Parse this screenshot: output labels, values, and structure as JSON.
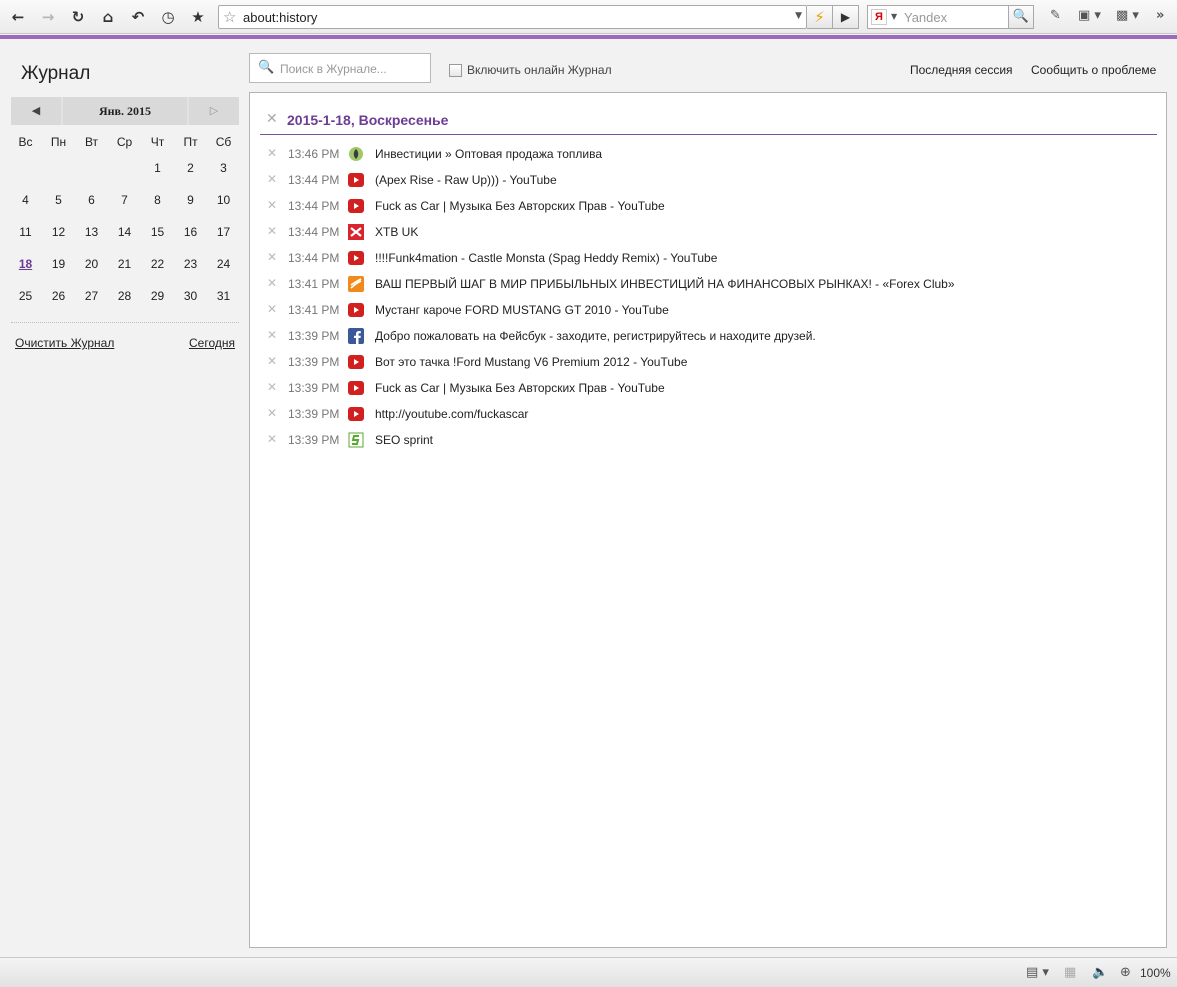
{
  "toolbar": {
    "url": "about:history",
    "search_engine_badge": "Я",
    "search_placeholder": "Yandex",
    "icons": [
      "back-icon",
      "forward-icon",
      "reload-icon",
      "home-icon",
      "undo-icon",
      "history-icon",
      "bookmark-star-icon",
      "lightning-icon",
      "go-icon",
      "search-icon",
      "pencil-icon",
      "camera-icon",
      "puzzle-icon",
      "overflow-icon"
    ]
  },
  "sidebar": {
    "title": "Журнал",
    "calendar": {
      "month": "Янв. 2015",
      "weekdays": [
        "Вс",
        "Пн",
        "Вт",
        "Ср",
        "Чт",
        "Пт",
        "Сб"
      ],
      "weeks": [
        [
          "",
          "",
          "",
          "",
          "1",
          "2",
          "3"
        ],
        [
          "4",
          "5",
          "6",
          "7",
          "8",
          "9",
          "10"
        ],
        [
          "11",
          "12",
          "13",
          "14",
          "15",
          "16",
          "17"
        ],
        [
          "18",
          "19",
          "20",
          "21",
          "22",
          "23",
          "24"
        ],
        [
          "25",
          "26",
          "27",
          "28",
          "29",
          "30",
          "31"
        ]
      ],
      "selected_day": "18"
    },
    "clear_label": "Очистить Журнал",
    "today_label": "Сегодня"
  },
  "top": {
    "search_placeholder": "Поиск в Журнале...",
    "online_label": "Включить онлайн Журнал",
    "last_session": "Последняя сессия",
    "report": "Сообщить о проблеме"
  },
  "day": {
    "title": "2015-1-18, Воскресенье",
    "entries": [
      {
        "time": "13:46 PM",
        "icon": "investment-site-icon",
        "title": "Инвестиции » Оптовая продажа топлива"
      },
      {
        "time": "13:44 PM",
        "icon": "youtube-icon",
        "title": "(Apex Rise - Raw Up))) - YouTube"
      },
      {
        "time": "13:44 PM",
        "icon": "youtube-icon",
        "title": "Fuck as Car | Музыка Без Авторских Прав - YouTube"
      },
      {
        "time": "13:44 PM",
        "icon": "xtb-icon",
        "title": "XTB UK"
      },
      {
        "time": "13:44 PM",
        "icon": "youtube-icon",
        "title": "!!!!Funk4mation - Castle Monsta (Spag Heddy Remix) - YouTube"
      },
      {
        "time": "13:41 PM",
        "icon": "forex-club-icon",
        "title": "ВАШ ПЕРВЫЙ ШАГ В МИР ПРИБЫЛЬНЫХ ИНВЕСТИЦИЙ НА ФИНАНСОВЫХ РЫНКАХ! - «Forex Club»"
      },
      {
        "time": "13:41 PM",
        "icon": "youtube-icon",
        "title": "Мустанг кароче FORD MUSTANG GT 2010 - YouTube"
      },
      {
        "time": "13:39 PM",
        "icon": "facebook-icon",
        "title": "Добро пожаловать на Фейсбук - заходите, регистрируйтесь и находите друзей."
      },
      {
        "time": "13:39 PM",
        "icon": "youtube-icon",
        "title": "Вот это тачка !Ford Mustang V6 Premium 2012 - YouTube"
      },
      {
        "time": "13:39 PM",
        "icon": "youtube-icon",
        "title": "Fuck as Car | Музыка Без Авторских Прав - YouTube"
      },
      {
        "time": "13:39 PM",
        "icon": "youtube-icon",
        "title": "http://youtube.com/fuckascar"
      },
      {
        "time": "13:39 PM",
        "icon": "seo-sprint-icon",
        "title": "SEO sprint"
      }
    ]
  },
  "status": {
    "zoom": "100%"
  },
  "colors": {
    "accent": "#9a6bbd",
    "date_title": "#6d3d94",
    "youtube": "#d12020"
  }
}
